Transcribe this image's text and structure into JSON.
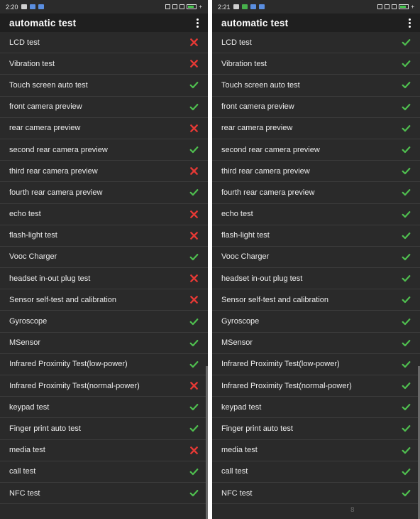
{
  "colors": {
    "pass": "#4fbf4f",
    "fail": "#e53935"
  },
  "left": {
    "time": "2:20",
    "title": "automatic test",
    "items": [
      {
        "label": "LCD test",
        "status": "fail"
      },
      {
        "label": "Vibration test",
        "status": "fail"
      },
      {
        "label": "Touch screen auto test",
        "status": "pass"
      },
      {
        "label": "front camera preview",
        "status": "pass"
      },
      {
        "label": "rear camera preview",
        "status": "fail"
      },
      {
        "label": "second rear camera preview",
        "status": "pass"
      },
      {
        "label": "third rear camera preview",
        "status": "fail"
      },
      {
        "label": "fourth rear camera preview",
        "status": "pass"
      },
      {
        "label": "echo test",
        "status": "fail"
      },
      {
        "label": "flash-light test",
        "status": "fail"
      },
      {
        "label": "Vooc Charger",
        "status": "pass"
      },
      {
        "label": "headset in-out plug test",
        "status": "fail"
      },
      {
        "label": "Sensor self-test and calibration",
        "status": "fail"
      },
      {
        "label": "Gyroscope",
        "status": "pass"
      },
      {
        "label": "MSensor",
        "status": "pass"
      },
      {
        "label": "Infrared Proximity Test(low-power)",
        "status": "pass"
      },
      {
        "label": "Infrared Proximity Test(normal-power)",
        "status": "fail"
      },
      {
        "label": "keypad test",
        "status": "pass"
      },
      {
        "label": "Finger print auto test",
        "status": "pass"
      },
      {
        "label": "media test",
        "status": "fail"
      },
      {
        "label": "call test",
        "status": "pass"
      },
      {
        "label": "NFC test",
        "status": "pass"
      }
    ]
  },
  "right": {
    "time": "2:21",
    "title": "automatic test",
    "page_number": "8",
    "items": [
      {
        "label": "LCD test",
        "status": "pass"
      },
      {
        "label": "Vibration test",
        "status": "pass"
      },
      {
        "label": "Touch screen auto test",
        "status": "pass"
      },
      {
        "label": "front camera preview",
        "status": "pass"
      },
      {
        "label": "rear camera preview",
        "status": "pass"
      },
      {
        "label": "second rear camera preview",
        "status": "pass"
      },
      {
        "label": "third rear camera preview",
        "status": "pass"
      },
      {
        "label": "fourth rear camera preview",
        "status": "pass"
      },
      {
        "label": "echo test",
        "status": "pass"
      },
      {
        "label": "flash-light test",
        "status": "pass"
      },
      {
        "label": "Vooc Charger",
        "status": "pass"
      },
      {
        "label": "headset in-out plug test",
        "status": "pass"
      },
      {
        "label": "Sensor self-test and calibration",
        "status": "pass"
      },
      {
        "label": "Gyroscope",
        "status": "pass"
      },
      {
        "label": "MSensor",
        "status": "pass"
      },
      {
        "label": "Infrared Proximity Test(low-power)",
        "status": "pass"
      },
      {
        "label": "Infrared Proximity Test(normal-power)",
        "status": "pass"
      },
      {
        "label": "keypad test",
        "status": "pass"
      },
      {
        "label": "Finger print auto test",
        "status": "pass"
      },
      {
        "label": "media test",
        "status": "pass"
      },
      {
        "label": "call test",
        "status": "pass"
      },
      {
        "label": "NFC test",
        "status": "pass"
      }
    ]
  }
}
